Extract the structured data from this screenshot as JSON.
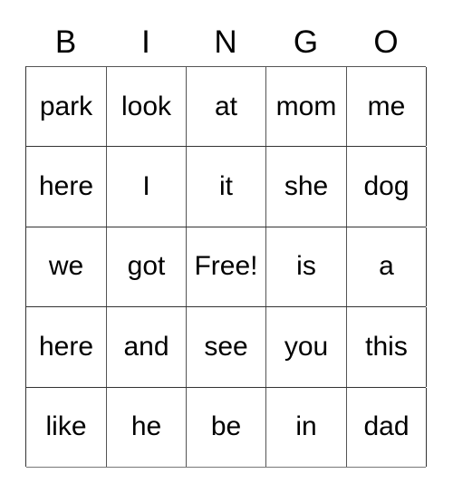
{
  "card": {
    "header": {
      "letters": [
        "B",
        "I",
        "N",
        "G",
        "O"
      ]
    },
    "grid": {
      "rows": [
        {
          "cells": [
            {
              "text": "park"
            },
            {
              "text": "look"
            },
            {
              "text": "at"
            },
            {
              "text": "mom"
            },
            {
              "text": "me"
            }
          ]
        },
        {
          "cells": [
            {
              "text": "here"
            },
            {
              "text": "I"
            },
            {
              "text": "it"
            },
            {
              "text": "she"
            },
            {
              "text": "dog"
            }
          ]
        },
        {
          "cells": [
            {
              "text": "we"
            },
            {
              "text": "got"
            },
            {
              "text": "Free!"
            },
            {
              "text": "is"
            },
            {
              "text": "a"
            }
          ]
        },
        {
          "cells": [
            {
              "text": "here"
            },
            {
              "text": "and"
            },
            {
              "text": "see"
            },
            {
              "text": "you"
            },
            {
              "text": "this"
            }
          ]
        },
        {
          "cells": [
            {
              "text": "like"
            },
            {
              "text": "he"
            },
            {
              "text": "be"
            },
            {
              "text": "in"
            },
            {
              "text": "dad"
            }
          ]
        }
      ]
    },
    "colors": {
      "background": "#ffffff",
      "text": "#000000",
      "grid_line": "#333333",
      "grid_line_light": "#555555"
    }
  }
}
